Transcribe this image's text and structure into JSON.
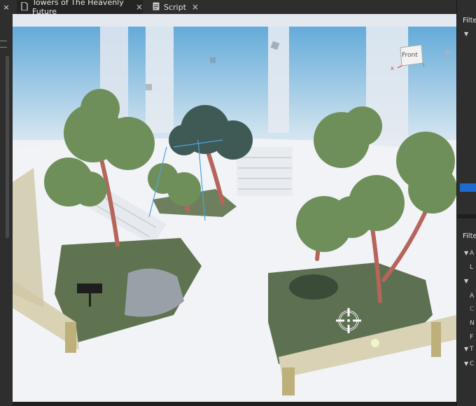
{
  "tabs": [
    {
      "label": "Towers of The Heavenly Future",
      "icon": "document-icon",
      "active": true
    },
    {
      "label": "Script",
      "icon": "script-icon",
      "active": false
    }
  ],
  "close_symbol": "×",
  "viewcube": {
    "face": "Front",
    "axis_x": "x"
  },
  "viewport_edge_text": "P",
  "right_panel": {
    "filter_top": "Filte",
    "filter_bottom": "Filte",
    "rows_bottom": [
      "A",
      "L",
      "A",
      "C",
      "N",
      "F",
      "T",
      "C"
    ]
  },
  "colors": {
    "selection": "#1d6bd0",
    "tab_bg": "#2e2e2e",
    "active_tab_bg": "#242424"
  }
}
